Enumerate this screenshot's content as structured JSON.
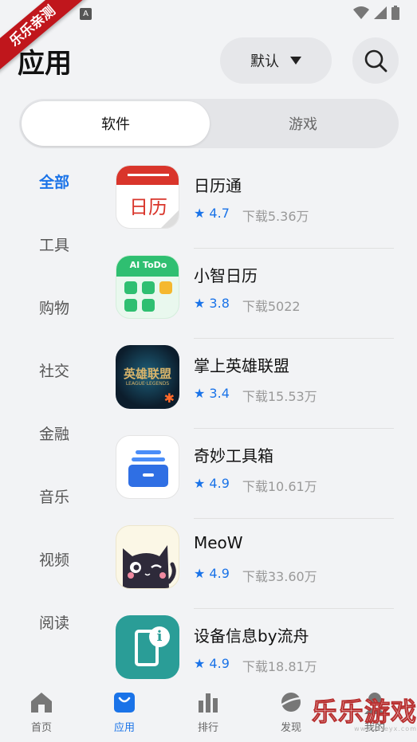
{
  "status_bar": {
    "badge_letter": "A",
    "ribbon_text": "乐乐亲测"
  },
  "header": {
    "title": "应用",
    "sort_label": "默认"
  },
  "segment": {
    "tabs": [
      "软件",
      "游戏"
    ],
    "active": 0
  },
  "categories": [
    "全部",
    "工具",
    "购物",
    "社交",
    "金融",
    "音乐",
    "视频",
    "阅读"
  ],
  "apps": [
    {
      "name": "日历通",
      "rating": "★ 4.7",
      "downloads": "下载5.36万",
      "icon": "calendar-icon",
      "icon_text": "日历"
    },
    {
      "name": "小智日历",
      "rating": "★ 3.8",
      "downloads": "下载5022",
      "icon": "ai-todo-icon",
      "icon_text": "AI ToDo"
    },
    {
      "name": "掌上英雄联盟",
      "rating": "★ 3.4",
      "downloads": "下载15.53万",
      "icon": "lol-icon",
      "icon_text": "英雄联盟",
      "icon_subtext": "LEAGUE·LEGENDS"
    },
    {
      "name": "奇妙工具箱",
      "rating": "★ 4.9",
      "downloads": "下载10.61万",
      "icon": "toolbox-icon"
    },
    {
      "name": "MeoW",
      "rating": "★ 4.9",
      "downloads": "下载33.60万",
      "icon": "cat-icon"
    },
    {
      "name": "设备信息by流舟",
      "rating": "★ 4.9",
      "downloads": "下载18.81万",
      "icon": "device-info-icon"
    }
  ],
  "tabbar": {
    "items": [
      {
        "label": "首页",
        "icon": "home-icon"
      },
      {
        "label": "应用",
        "icon": "bag-icon"
      },
      {
        "label": "排行",
        "icon": "bar-chart-icon"
      },
      {
        "label": "发现",
        "icon": "planet-icon"
      },
      {
        "label": "我的",
        "icon": "user-icon"
      }
    ],
    "active": 1
  },
  "watermark": {
    "text": "乐乐游戏",
    "sub": "www.leleyx.com"
  },
  "colors": {
    "accent": "#1a73e8",
    "ribbon": "#c0161c",
    "background": "#f2f3f5"
  }
}
